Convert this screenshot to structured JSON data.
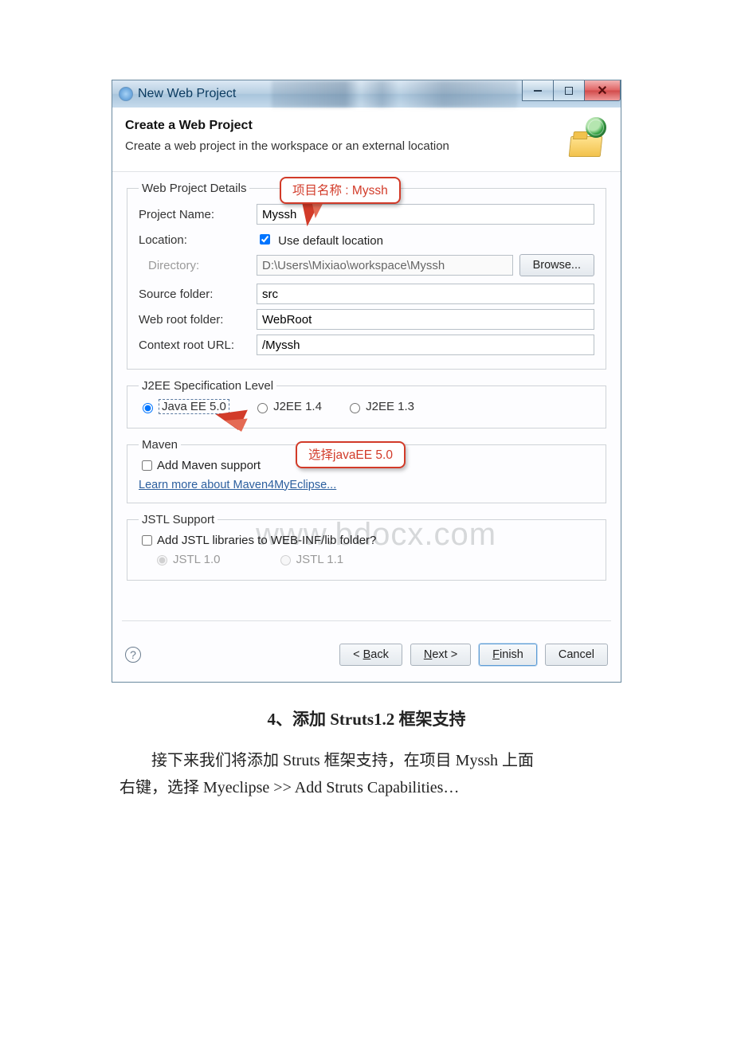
{
  "window": {
    "title": "New Web Project"
  },
  "header": {
    "title": "Create a Web Project",
    "subtitle": "Create a web project in the workspace or an external location"
  },
  "callouts": {
    "project_name": "项目名称 : Myssh",
    "javaee": "选择javaEE 5.0"
  },
  "details": {
    "legend": "Web Project Details",
    "labels": {
      "project_name": "Project Name:",
      "location": "Location:",
      "directory": "Directory:",
      "source_folder": "Source folder:",
      "web_root": "Web root folder:",
      "context_root": "Context root URL:"
    },
    "values": {
      "project_name": "Myssh",
      "use_default": "Use default location",
      "directory": "D:\\Users\\Mixiao\\workspace\\Myssh",
      "source_folder": "src",
      "web_root": "WebRoot",
      "context_root": "/Myssh",
      "browse": "Browse..."
    }
  },
  "j2ee": {
    "legend": "J2EE Specification Level",
    "opt1": "Java EE 5.0",
    "opt2": "J2EE 1.4",
    "opt3": "J2EE 1.3"
  },
  "maven": {
    "legend": "Maven",
    "add": "Add Maven support",
    "link": "Learn more about Maven4MyEclipse..."
  },
  "jstl": {
    "legend": "JSTL Support",
    "add": "Add JSTL libraries to WEB-INF/lib folder?",
    "opt1": "JSTL 1.0",
    "opt2": "JSTL 1.1"
  },
  "watermark": "www.bdocx.com",
  "buttons": {
    "back": "< Back",
    "next": "Next >",
    "finish": "Finish",
    "cancel": "Cancel"
  },
  "article": {
    "heading": "4、添加 Struts1.2 框架支持",
    "line1": "接下来我们将添加 Struts 框架支持，在项目 Myssh 上面右键，选择 Myeclipse >> Add Struts Capabilities…"
  }
}
